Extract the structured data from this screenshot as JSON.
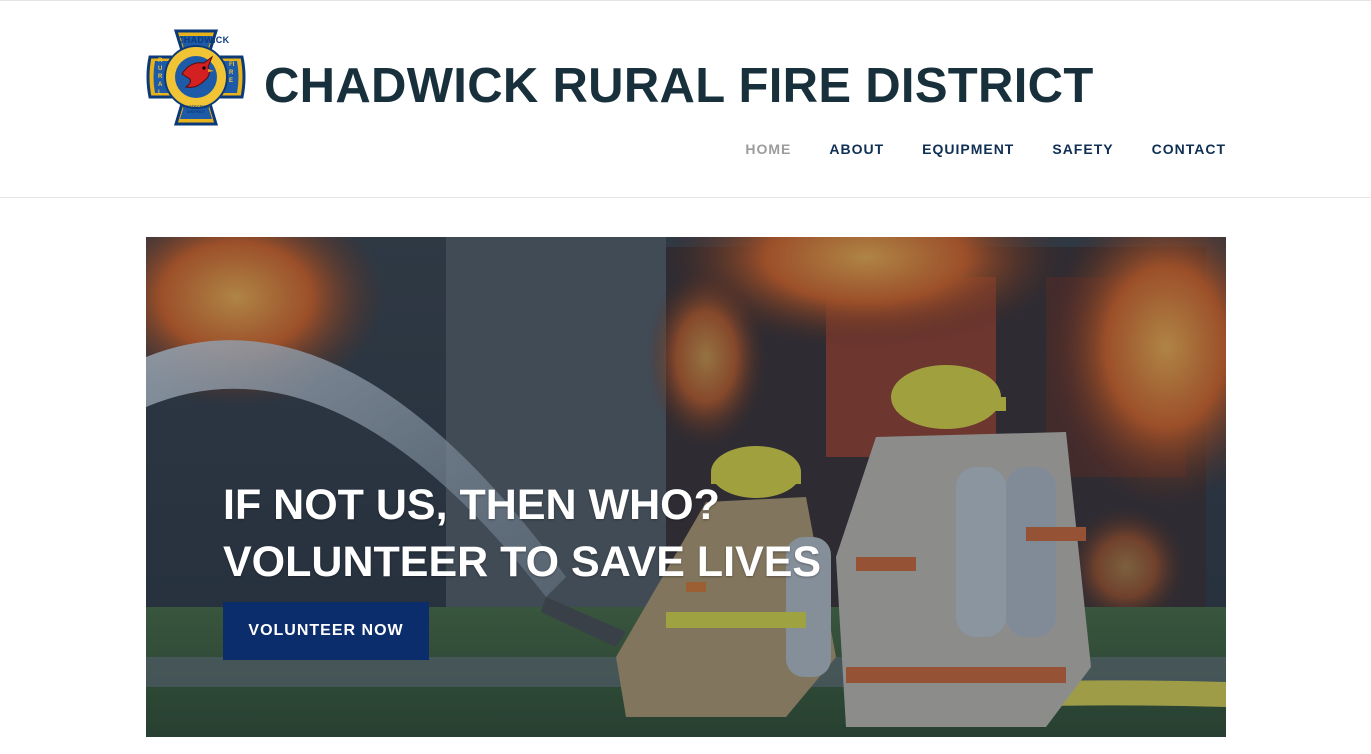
{
  "site": {
    "title": "CHADWICK RURAL FIRE DISTRICT",
    "logo": {
      "top_text": "CHADWICK",
      "left_text": "RURAL",
      "right_text": "FIRE",
      "bottom_text": "PROTECTION DISTRICT",
      "icon": "maltese-cross-cardinal-logo"
    }
  },
  "nav": {
    "items": [
      {
        "label": "HOME",
        "active": true
      },
      {
        "label": "ABOUT",
        "active": false
      },
      {
        "label": "EQUIPMENT",
        "active": false
      },
      {
        "label": "SAFETY",
        "active": false
      },
      {
        "label": "CONTACT",
        "active": false
      }
    ]
  },
  "hero": {
    "line1": "IF NOT US, THEN WHO?",
    "line2": "VOLUNTEER TO SAVE LIVES",
    "button_label": "VOLUNTEER NOW",
    "image": "firefighters-spraying-house-fire"
  },
  "colors": {
    "title": "#17303b",
    "nav": "#0f2f55",
    "nav_active": "#9c9c9c",
    "button": "#0b2d6b"
  }
}
